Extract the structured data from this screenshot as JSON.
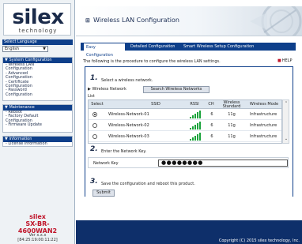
{
  "sidebar": {
    "logo_word": "silex",
    "logo_tag": "technology",
    "language_label": "Select Language",
    "language_value": "English",
    "system_section": {
      "header": "System Configuration",
      "items": [
        "- Wireless LAN",
        "  Configuration",
        "- Advanced",
        "  Configuration",
        "- Certificate",
        "  Configuration",
        "- Password",
        "  Configuration"
      ]
    },
    "maintenance_section": {
      "header": "Maintenance",
      "items": [
        "- Reboot",
        "- Factory Default",
        "  Configuration",
        "- Firmware Update"
      ]
    },
    "information_section": {
      "header": "Information",
      "items": [
        "- License Information"
      ]
    },
    "model": {
      "line1": "silex",
      "line2": "SX-BR-",
      "line3": "4600WAN2",
      "version": "Ver x.x.x",
      "build": "[84:25:19:00:11:22]"
    }
  },
  "header": {
    "title": "Wireless LAN Configuration"
  },
  "tabs": [
    {
      "label": "Easy Configuration",
      "active": true
    },
    {
      "label": "Detailed Configuration",
      "active": false
    },
    {
      "label": "Smart Wireless Setup Configuration",
      "active": false
    }
  ],
  "intro_text": "The following is the procedure to configure the wireless LAN settings.",
  "help_label": "HELP",
  "step1": {
    "number": "1.",
    "text": "Select a wireless network.",
    "list_label": "Wireless Network List",
    "search_button": "Search Wireless Networks"
  },
  "network_table": {
    "headers": {
      "select": "Select",
      "ssid": "SSID",
      "rssi": "RSSI",
      "ch": "CH",
      "std1": "Wireless",
      "std2": "Standard",
      "mode": "Wireless Mode"
    },
    "rows": [
      {
        "selected": true,
        "ssid": "Wireless-Network-01",
        "rssi_bars": 5,
        "ch": "6",
        "standard": "11g",
        "mode": "Infrastructure"
      },
      {
        "selected": false,
        "ssid": "Wireless-Network-02",
        "rssi_bars": 5,
        "ch": "6",
        "standard": "11g",
        "mode": "Infrastructure"
      },
      {
        "selected": false,
        "ssid": "Wireless-Network-03",
        "rssi_bars": 5,
        "ch": "6",
        "standard": "11g",
        "mode": "Infrastructure"
      }
    ]
  },
  "step2": {
    "number": "2.",
    "text": "Enter the Network Key.",
    "key_label": "Network Key",
    "key_value": "●●●●●●●●"
  },
  "step3": {
    "number": "3.",
    "text": "Save the configuration and reboot this product.",
    "submit_button": "Submit"
  },
  "footer": {
    "copyright": "Copyright (C) 2015 silex technology, Inc."
  },
  "colors": {
    "navy": "#0e3f8a",
    "footer_navy": "#0e2f6a",
    "model_red": "#c0152a",
    "signal_green": "#1aa33a"
  }
}
